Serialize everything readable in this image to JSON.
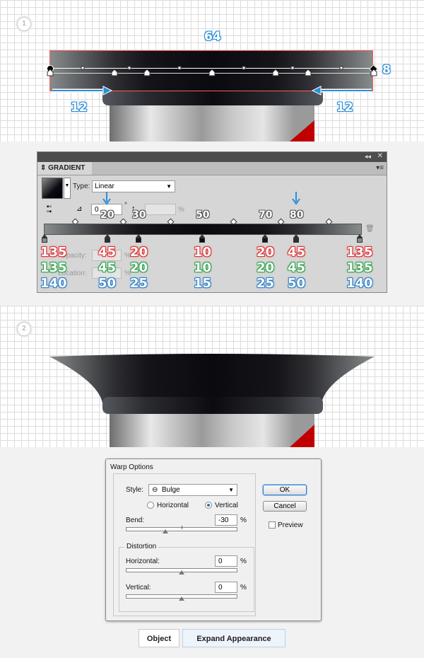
{
  "step1": {
    "badge": "1",
    "width_label": "64",
    "height_label": "8",
    "left_offset": "12",
    "right_offset": "12"
  },
  "gradient_panel": {
    "tab_label": "GRADIENT",
    "type_label": "Type:",
    "type_value": "Linear",
    "angle_value": "0",
    "degree_symbol": "°",
    "percent_symbol": "%",
    "ghost_opacity": "Opacity:",
    "ghost_location": "Location:",
    "locations": [
      "20",
      "30",
      "50",
      "70",
      "80"
    ],
    "columns": [
      {
        "r": "135",
        "g": "135",
        "b": "140"
      },
      {
        "r": "45",
        "g": "45",
        "b": "50"
      },
      {
        "r": "20",
        "g": "20",
        "b": "25"
      },
      {
        "r": "10",
        "g": "10",
        "b": "15"
      },
      {
        "r": "20",
        "g": "20",
        "b": "25"
      },
      {
        "r": "45",
        "g": "45",
        "b": "50"
      },
      {
        "r": "135",
        "g": "135",
        "b": "140"
      }
    ]
  },
  "step2": {
    "badge": "2"
  },
  "warp": {
    "title": "Warp Options",
    "style_label": "Style:",
    "style_value": "Bulge",
    "horizontal_label": "Horizontal",
    "vertical_label": "Vertical",
    "bend_label": "Bend:",
    "bend_value": "-30",
    "distortion_label": "Distortion",
    "dist_horizontal_label": "Horizontal:",
    "dist_horizontal_value": "0",
    "dist_vertical_label": "Vertical:",
    "dist_vertical_value": "0",
    "percent": "%",
    "ok": "OK",
    "cancel": "Cancel",
    "preview": "Preview"
  },
  "menu": {
    "object": "Object",
    "expand_appearance": "Expand Appearance"
  }
}
